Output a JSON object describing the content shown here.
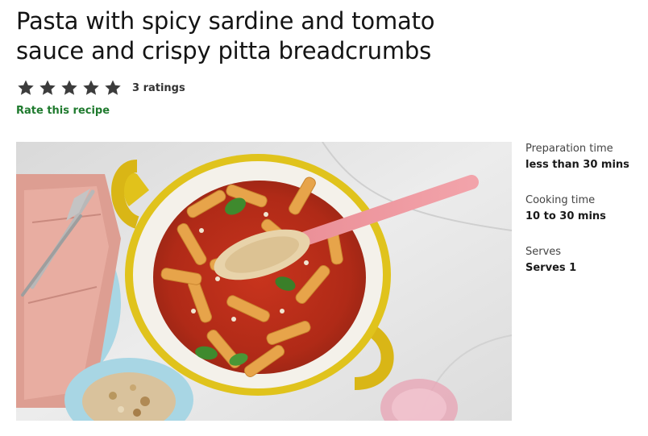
{
  "recipe": {
    "title": "Pasta with spicy sardine and tomato sauce and crispy pitta breadcrumbs",
    "rating": {
      "stars": 5,
      "filled": 5,
      "count_label": "3 ratings",
      "star_icon": "star-icon",
      "star_color": "#3c3c3c"
    },
    "rate_link": "Rate this recipe",
    "rate_link_color": "#1f7a2e",
    "image": {
      "alt": "Pasta with spicy sardine and tomato sauce in a yellow pan with a pink wooden spoon"
    },
    "info": [
      {
        "label": "Preparation time",
        "value": "less than 30 mins"
      },
      {
        "label": "Cooking time",
        "value": "10 to 30 mins"
      },
      {
        "label": "Serves",
        "value": "Serves 1"
      }
    ]
  }
}
